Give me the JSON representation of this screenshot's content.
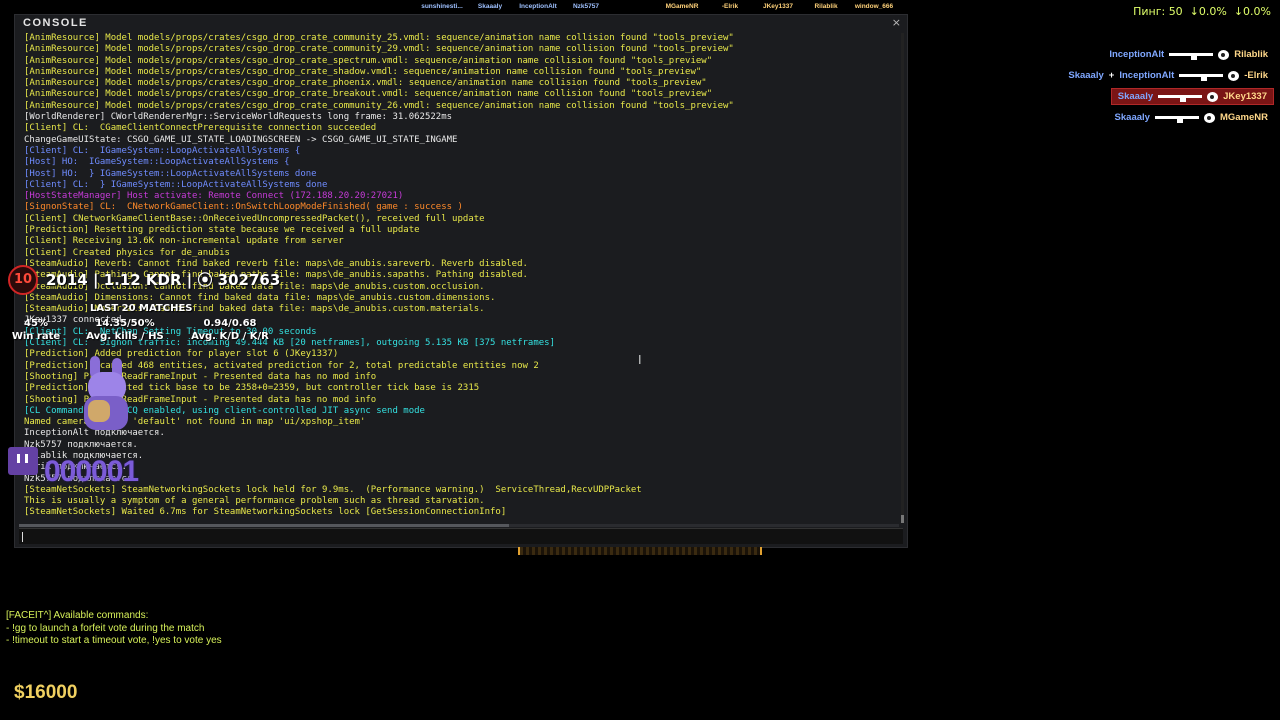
{
  "colors": {
    "console_bg": "#1b1c1f",
    "yellow_text": "#e8e84a",
    "blue_text": "#6f8cff",
    "orange_text": "#ff8a2a",
    "magenta_text": "#c63bd8",
    "cyan_text": "#34e0e0",
    "ct_color": "#7fa7ff",
    "t_color": "#ffd88a",
    "self_kill_bg": "#7a1515",
    "money_color": "#f0d060",
    "faceit_red": "#d12525",
    "twitch_purple": "#6441a4"
  },
  "console": {
    "title": "CONSOLE",
    "close": "×",
    "input_value": "",
    "lines": [
      "[AnimResource] Model models/props/crates/csgo_drop_crate_community_25.vmdl: sequence/animation name collision found \"tools_preview\"",
      "[AnimResource] Model models/props/crates/csgo_drop_crate_community_29.vmdl: sequence/animation name collision found \"tools_preview\"",
      "[AnimResource] Model models/props/crates/csgo_drop_crate_spectrum.vmdl: sequence/animation name collision found \"tools_preview\"",
      "[AnimResource] Model models/props/crates/csgo_drop_crate_shadow.vmdl: sequence/animation name collision found \"tools_preview\"",
      "[AnimResource] Model models/props/crates/csgo_drop_crate_phoenix.vmdl: sequence/animation name collision found \"tools_preview\"",
      "[AnimResource] Model models/props/crates/csgo_drop_crate_breakout.vmdl: sequence/animation name collision found \"tools_preview\"",
      "[AnimResource] Model models/props/crates/csgo_drop_crate_community_26.vmdl: sequence/animation name collision found \"tools_preview\"",
      "[WorldRenderer] CWorldRendererMgr::ServiceWorldRequests long frame: 31.062522ms",
      "[Client] CL:  CGameClientConnectPrerequisite connection succeeded",
      "ChangeGameUIState: CSGO_GAME_UI_STATE_LOADINGSCREEN -> CSGO_GAME_UI_STATE_INGAME",
      "[Client] CL:  IGameSystem::LoopActivateAllSystems {",
      "[Host] HO:  IGameSystem::LoopActivateAllSystems {",
      "[Host] HO:  } IGameSystem::LoopActivateAllSystems done",
      "[Client] CL:  } IGameSystem::LoopActivateAllSystems done",
      "[HostStateManager] Host activate: Remote Connect (172.188.20.20:27021)",
      "[SignonState] CL:  CNetworkGameClient::OnSwitchLoopModeFinished( game : success )",
      "[Client] CNetworkGameClientBase::OnReceivedUncompressedPacket(), received full update",
      "[Prediction] Resetting prediction state because we received a full update",
      "[Client] Receiving 13.6K non-incremental update from server",
      "[Client] Created physics for de_anubis",
      "[SteamAudio] Reverb: Cannot find baked reverb file: maps\\de_anubis.sareverb. Reverb disabled.",
      "[SteamAudio] Pathing: Cannot find baked paths file: maps\\de_anubis.sapaths. Pathing disabled.",
      "[SteamAudio] Occlusion: Cannot find baked data file: maps\\de_anubis.custom.occlusion.",
      "[SteamAudio] Dimensions: Cannot find baked data file: maps\\de_anubis.custom.dimensions.",
      "[SteamAudio] Materials: Cannot find baked data file: maps\\de_anubis.custom.materials.",
      "JKey1337 connected.",
      "[Client] CL:  NetChan Setting Timeout to 30.00 seconds",
      "[Client] CL:  Signon traffic: incoming 49.444 KB [20 netframes], outgoing 5.135 KB [375 netframes]",
      "[Prediction] Added prediction for player slot 6 (JKey1337)",
      "[Prediction] Scanned 468 entities, activated prediction for 2, total predictable entities now 2",
      "[Shooting] ProcessReadFrameInput - Presented data has no mod info",
      "[Prediction] Predicted tick base to be 2358+0=2359, but controller tick base is 2315",
      "[Shooting] ProcessReadFrameInput - Presented data has no mod info",
      "[CL Command Queue] CQ enabled, using client-controlled JIT async send mode",
      "Named camera target 'default' not found in map 'ui/xpshop_item'",
      "InceptionAlt подключается.",
      "Nzk5757 подключается.",
      "Rilablik подключается.",
      "Elrik подключается.",
      "Nzk5757 подключается.",
      "[SteamNetSockets] SteamNetworkingSockets lock held for 9.9ms.  (Performance warning.)  ServiceThread,RecvUDPPacket",
      "This is usually a symptom of a general performance problem such as thread starvation.",
      "[SteamNetSockets] Waited 6.7ms for SteamNetworkingSockets lock [GetSessionConnectionInfo]"
    ]
  },
  "topbar": {
    "players": [
      "sunshinesti...",
      "Skaaaly",
      "InceptionAlt",
      "Nzk5757",
      "",
      "MGameNR",
      "-Elrik",
      "JKey1337",
      "Rilablik",
      "window_666"
    ]
  },
  "netstats": {
    "text": "Пинг: 50  ↓0.0%  ↓0.0%"
  },
  "killfeed": [
    {
      "assister": "",
      "killer": "InceptionAlt",
      "victim": "Rilablik",
      "weapon_icon": "rifle-icon",
      "headshot": true,
      "self": false
    },
    {
      "assister": "Skaaaly",
      "killer": "InceptionAlt",
      "victim": "-Elrik",
      "weapon_icon": "rifle-icon",
      "headshot": true,
      "self": false
    },
    {
      "assister": "",
      "killer": "Skaaaly",
      "victim": "JKey1337",
      "weapon_icon": "rifle-icon",
      "headshot": true,
      "self": true
    },
    {
      "assister": "",
      "killer": "Skaaaly",
      "victim": "MGameNR",
      "weapon_icon": "rifle-icon",
      "headshot": true,
      "self": false
    }
  ],
  "faceit": {
    "level": "10",
    "summary": "2014 | 1.12 KDR | ⦿ 302763",
    "last_matches": "LAST 20 MATCHES",
    "stats": [
      {
        "value": "45%",
        "label": "Win rate"
      },
      {
        "value": "14.35/50%",
        "label": "Avg. kills / HS"
      },
      {
        "value": "0.94/0.68",
        "label": "Avg. K/D / K/R"
      }
    ]
  },
  "twitch": {
    "count": "000001"
  },
  "faceit_commands": [
    "[FACEIT^] Available commands:",
    "- !gg to launch a forfeit vote during the match",
    "- !timeout to start a timeout vote, !yes to vote yes"
  ],
  "money": "$16000"
}
